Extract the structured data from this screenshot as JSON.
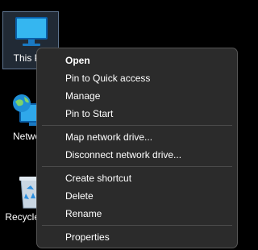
{
  "desktop": {
    "icons": [
      {
        "label": "This PC",
        "icon": "computer-monitor-icon"
      },
      {
        "label": "Network",
        "icon": "network-globe-icon"
      },
      {
        "label": "Recycle Bin",
        "icon": "recycle-bin-icon"
      }
    ]
  },
  "context_menu": {
    "items": [
      {
        "label": "Open"
      },
      {
        "label": "Pin to Quick access"
      },
      {
        "label": "Manage"
      },
      {
        "label": "Pin to Start"
      },
      {
        "label": "Map network drive..."
      },
      {
        "label": "Disconnect network drive..."
      },
      {
        "label": "Create shortcut"
      },
      {
        "label": "Delete"
      },
      {
        "label": "Rename"
      },
      {
        "label": "Properties"
      }
    ]
  },
  "colors": {
    "desktop_bg": "#000000",
    "menu_bg": "#2b2b2b",
    "menu_text": "#ffffff",
    "selection": "#5f7590"
  }
}
